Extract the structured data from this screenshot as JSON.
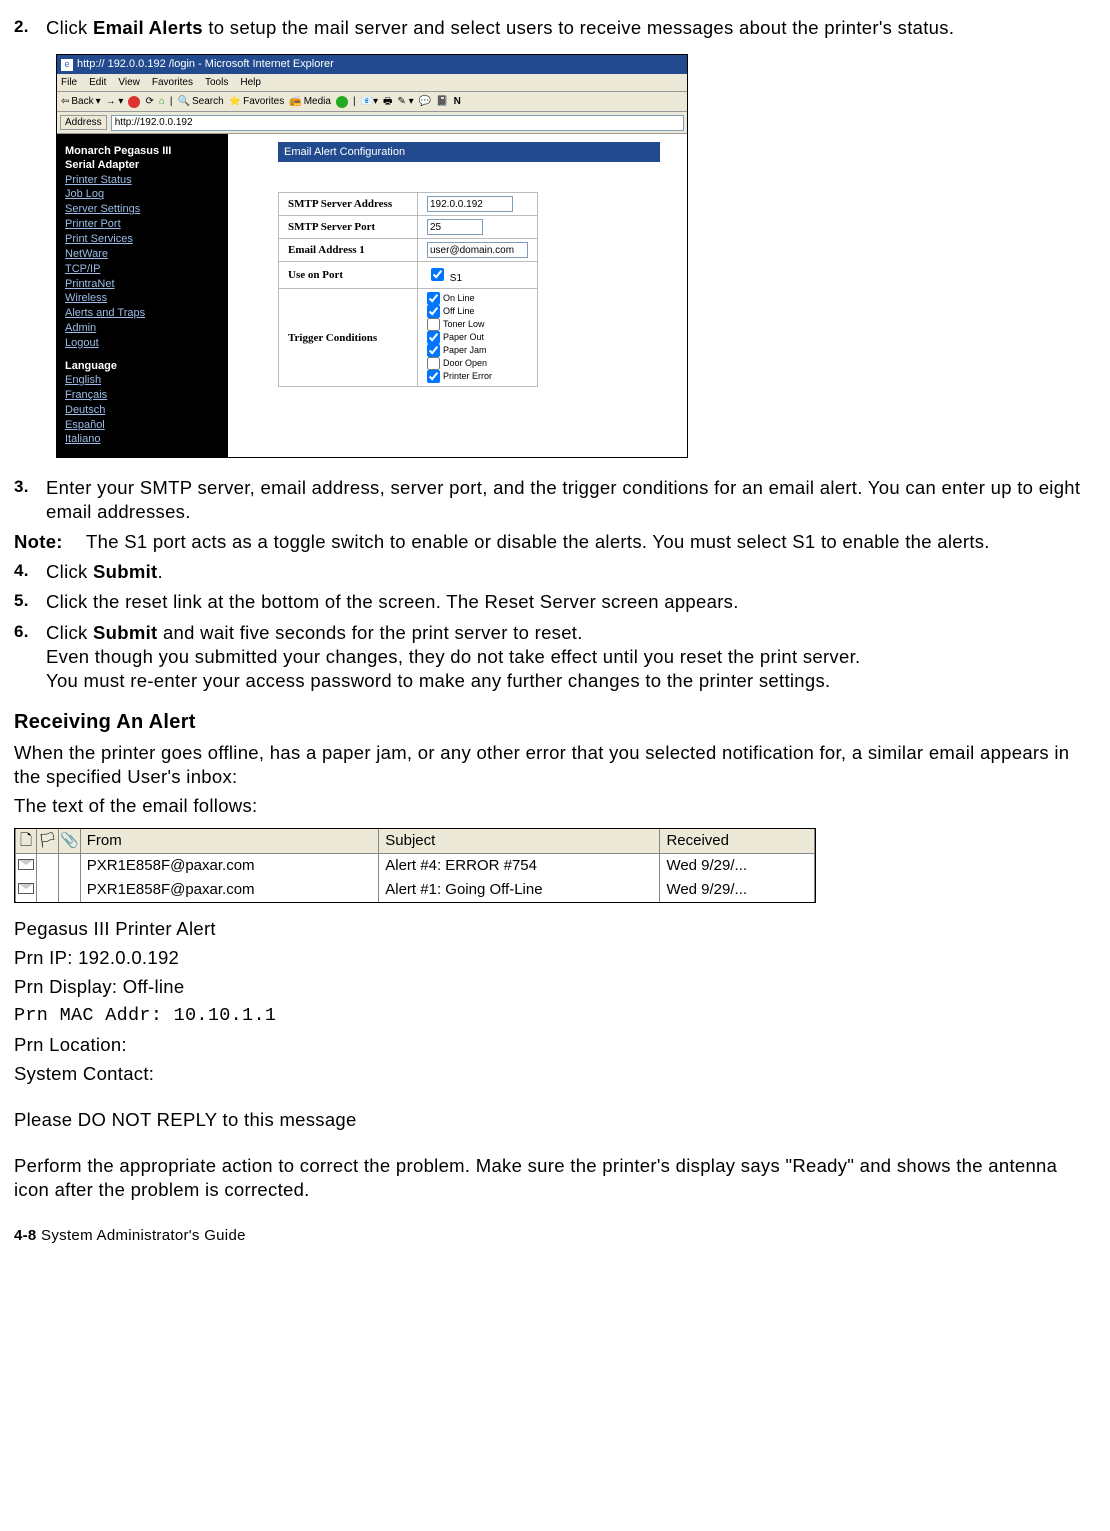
{
  "steps": {
    "s2": {
      "num": "2.",
      "pre": "Click ",
      "bold": "Email Alerts",
      "post": " to setup the mail server and select users to receive messages about the printer's status."
    },
    "s3": {
      "num": "3.",
      "text": "Enter your SMTP server, email address, server port, and the trigger conditions for an email alert.  You can enter up to eight email addresses."
    },
    "s4": {
      "num": "4.",
      "pre": "Click ",
      "bold": "Submit",
      "post": "."
    },
    "s5": {
      "num": "5.",
      "text": "Click the reset link at the bottom of the screen.  The Reset Server screen appears."
    },
    "s6": {
      "num": "6.",
      "pre": "Click ",
      "bold": "Submit",
      "post": " and wait five seconds for the print server to reset.",
      "line2": "Even though you submitted your changes, they do not take effect until you reset the print server.",
      "line3": "You must re-enter your access password to make any further changes to the printer settings."
    }
  },
  "note": {
    "label": "Note:",
    "text": "The S1 port acts as a toggle switch to enable or disable the alerts.  You must select S1 to enable the alerts."
  },
  "ie": {
    "title": "http:// 192.0.0.192  /login - Microsoft Internet Explorer",
    "menu": [
      "File",
      "Edit",
      "View",
      "Favorites",
      "Tools",
      "Help"
    ],
    "tb": {
      "back": "Back",
      "search": "Search",
      "fav": "Favorites",
      "media": "Media"
    },
    "addr_label": "Address",
    "addr_value": "http://192.0.0.192",
    "brand1": "Monarch Pegasus III",
    "brand2": "Serial Adapter",
    "nav": [
      "Printer Status",
      "Job Log",
      "Server Settings",
      "Printer Port",
      "Print Services",
      "NetWare",
      "TCP/IP",
      "PrintraNet",
      "Wireless",
      "Alerts and Traps",
      "Admin",
      "Logout"
    ],
    "lang_label": "Language",
    "langs": [
      "English",
      "Français",
      "Deutsch",
      "Español",
      "Italiano"
    ],
    "panel_title": "Email Alert Configuration",
    "rows": {
      "smtp_addr": {
        "label": "SMTP Server Address",
        "value": "192.0.0.192"
      },
      "smtp_port": {
        "label": "SMTP Server Port",
        "value": "25"
      },
      "email1": {
        "label": "Email Address 1",
        "value": "user@domain.com"
      },
      "use_port": {
        "label": "Use on Port",
        "cb": "S1"
      },
      "trigger": {
        "label": "Trigger Conditions",
        "opts": [
          {
            "label": "On Line",
            "checked": true,
            "gray": false
          },
          {
            "label": "Off Line",
            "checked": true,
            "gray": false
          },
          {
            "label": "Toner Low",
            "checked": false,
            "gray": true
          },
          {
            "label": "Paper Out",
            "checked": true,
            "gray": false
          },
          {
            "label": "Paper Jam",
            "checked": true,
            "gray": false
          },
          {
            "label": "Door Open",
            "checked": false,
            "gray": true
          },
          {
            "label": "Printer Error",
            "checked": true,
            "gray": false
          }
        ]
      }
    }
  },
  "h2": "Receiving An Alert",
  "recv_para": "When the printer goes offline, has a paper jam, or any other error that you selected notification for, a similar email appears in the specified User's inbox:",
  "follows": "The text of the email follows:",
  "inbox": {
    "cols": {
      "from": "From",
      "subject": "Subject",
      "received": "Received"
    },
    "rows": [
      {
        "from": "PXR1E858F@paxar.com",
        "subject": "Alert #4: ERROR #754",
        "received": "Wed 9/29/..."
      },
      {
        "from": "PXR1E858F@paxar.com",
        "subject": "Alert #1: Going Off-Line",
        "received": "Wed 9/29/..."
      }
    ]
  },
  "email_body": {
    "l1": "Pegasus III Printer Alert",
    "l2": "Prn IP: 192.0.0.192",
    "l3": "Prn Display: Off-line",
    "l4": "Prn MAC Addr: 10.10.1.1",
    "l5": "Prn Location:",
    "l6": "System Contact:",
    "l7": "Please DO NOT REPLY to this message"
  },
  "closing": "Perform the appropriate action to correct the problem.  Make sure the printer's display says \"Ready\" and shows the antenna icon after the problem is corrected.",
  "footer": {
    "page": "4-8",
    "label": "  System Administrator's Guide"
  }
}
